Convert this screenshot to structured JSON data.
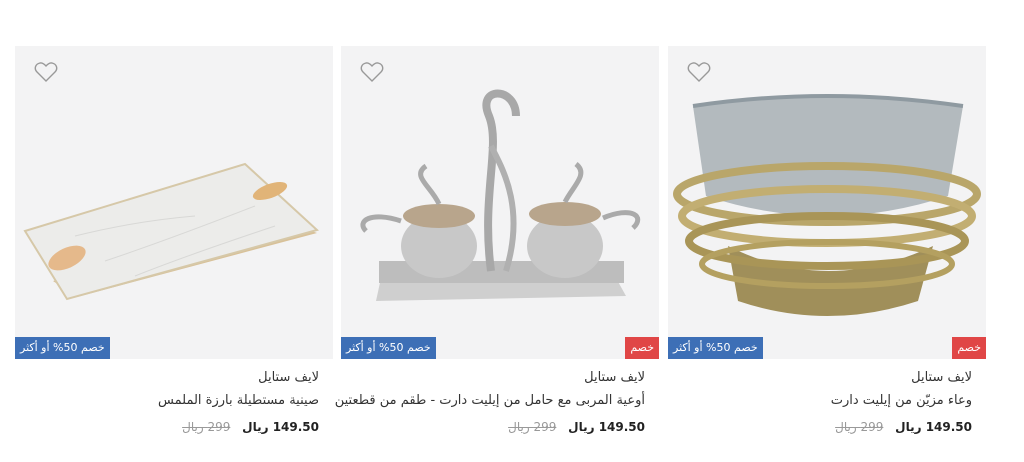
{
  "products": [
    {
      "brand": "لايف ستايل",
      "name": "صينية مستطيلة بارزة الملمس",
      "price_now": "149.50 ريال",
      "price_was": "299 ريال",
      "badge_blue": "خصم 50% أو أكثر",
      "badge_red": ""
    },
    {
      "brand": "لايف ستايل",
      "name": "أوعية المربى مع حامل من إيليت دارت - طقم من قطعتين",
      "price_now": "149.50 ريال",
      "price_was": "299 ريال",
      "badge_blue": "خصم 50% أو أكثر",
      "badge_red": "خصم"
    },
    {
      "brand": "لايف ستايل",
      "name": "وعاء مزيّن من إيليت دارت",
      "price_now": "149.50 ريال",
      "price_was": "299 ريال",
      "badge_blue": "خصم 50% أو أكثر",
      "badge_red": "خصم"
    }
  ],
  "icons": {
    "wishlist": "heart-outline-icon"
  },
  "colors": {
    "badge_blue": "#3d6fb6",
    "badge_red": "#e04646",
    "image_bg": "#f4f4f4"
  }
}
